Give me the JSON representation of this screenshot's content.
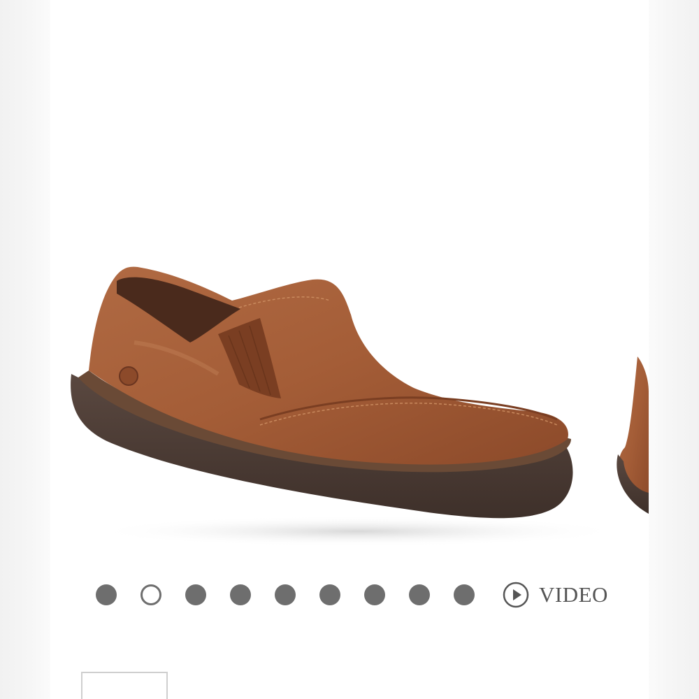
{
  "product": {
    "image_name": "brown-leather-slip-on-shoe",
    "colors": {
      "leather": "#a8603a",
      "leather_dark": "#7a3e22",
      "sole": "#4a3a33"
    }
  },
  "carousel": {
    "dot_count": 9,
    "active_index": 1,
    "video_label": "VIDEO",
    "colors": {
      "dot": "#6e6e6e",
      "text": "#555555"
    }
  }
}
